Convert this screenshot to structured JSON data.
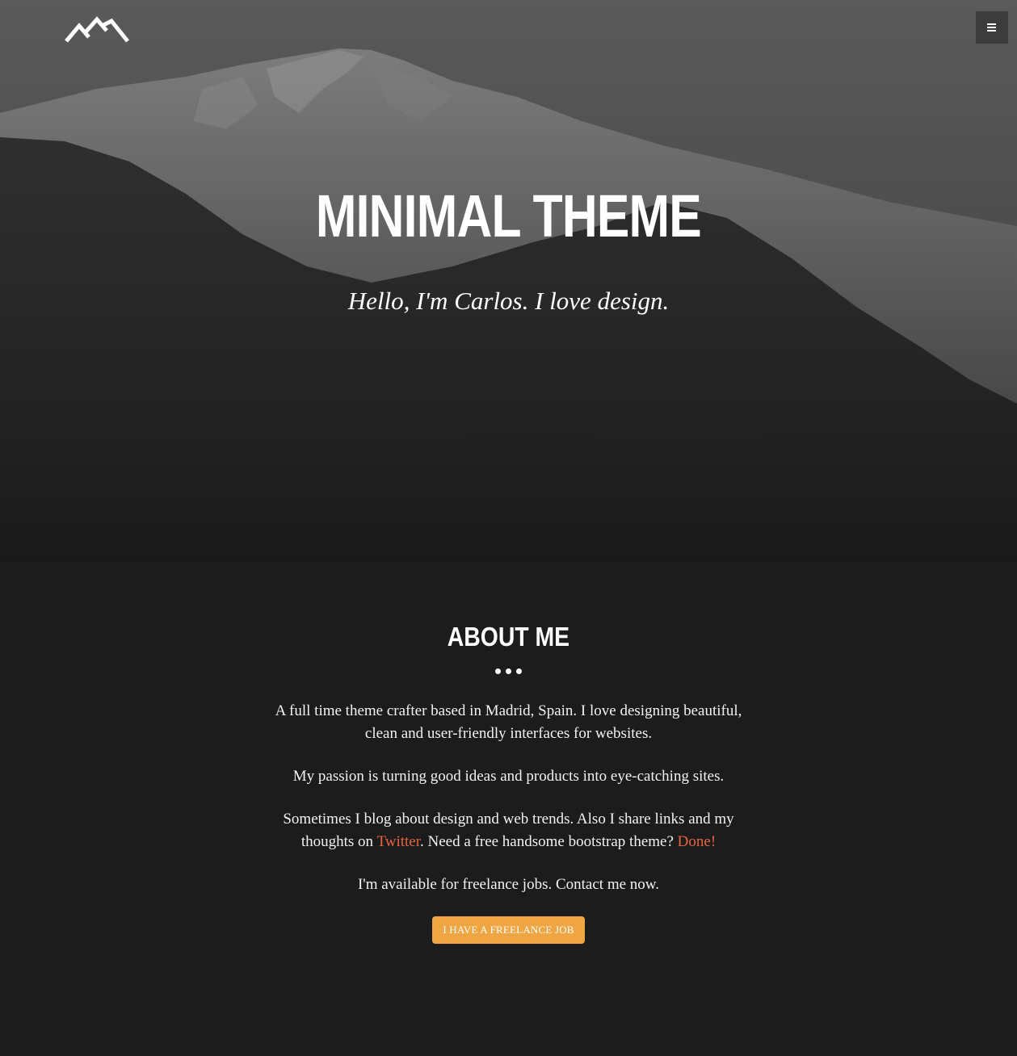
{
  "header": {
    "logo_icon": "mountain-logo-icon",
    "menu_icon": "hamburger-menu-icon"
  },
  "hero": {
    "title": "MINIMAL THEME",
    "subtitle": "Hello, I'm Carlos. I love design."
  },
  "about": {
    "title": "ABOUT ME",
    "paragraph1": "A full time theme crafter based in Madrid, Spain. I love designing beautiful, clean and user-friendly interfaces for websites.",
    "paragraph2": "My passion is turning good ideas and products into eye-catching sites.",
    "paragraph3_before_link": "Sometimes I blog about design and web trends. Also I share links and my thoughts on ",
    "twitter_link": "Twitter",
    "paragraph3_middle": ". Need a free handsome bootstrap theme? ",
    "done_link": "Done!",
    "paragraph4": "I'm available for freelance jobs. Contact me now.",
    "button_label": "I HAVE A FREELANCE JOB"
  },
  "colors": {
    "background": "#1c1c1c",
    "link": "#e7643f",
    "button": "#f0a543",
    "menu_button": "#3c3c3c"
  }
}
